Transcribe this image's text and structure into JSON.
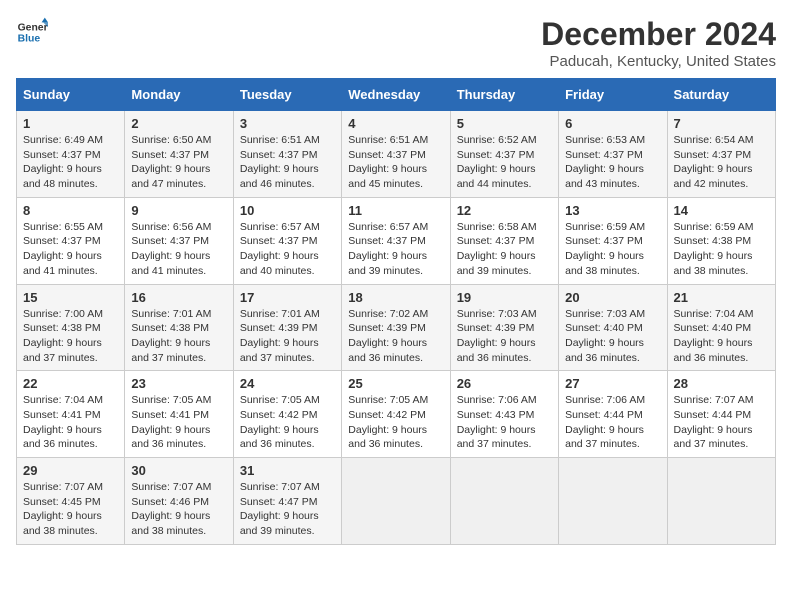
{
  "logo": {
    "line1": "General",
    "line2": "Blue"
  },
  "title": "December 2024",
  "subtitle": "Paducah, Kentucky, United States",
  "headers": [
    "Sunday",
    "Monday",
    "Tuesday",
    "Wednesday",
    "Thursday",
    "Friday",
    "Saturday"
  ],
  "weeks": [
    [
      {
        "day": "1",
        "sunrise": "6:49 AM",
        "sunset": "4:37 PM",
        "daylight": "9 hours and 48 minutes."
      },
      {
        "day": "2",
        "sunrise": "6:50 AM",
        "sunset": "4:37 PM",
        "daylight": "9 hours and 47 minutes."
      },
      {
        "day": "3",
        "sunrise": "6:51 AM",
        "sunset": "4:37 PM",
        "daylight": "9 hours and 46 minutes."
      },
      {
        "day": "4",
        "sunrise": "6:51 AM",
        "sunset": "4:37 PM",
        "daylight": "9 hours and 45 minutes."
      },
      {
        "day": "5",
        "sunrise": "6:52 AM",
        "sunset": "4:37 PM",
        "daylight": "9 hours and 44 minutes."
      },
      {
        "day": "6",
        "sunrise": "6:53 AM",
        "sunset": "4:37 PM",
        "daylight": "9 hours and 43 minutes."
      },
      {
        "day": "7",
        "sunrise": "6:54 AM",
        "sunset": "4:37 PM",
        "daylight": "9 hours and 42 minutes."
      }
    ],
    [
      {
        "day": "8",
        "sunrise": "6:55 AM",
        "sunset": "4:37 PM",
        "daylight": "9 hours and 41 minutes."
      },
      {
        "day": "9",
        "sunrise": "6:56 AM",
        "sunset": "4:37 PM",
        "daylight": "9 hours and 41 minutes."
      },
      {
        "day": "10",
        "sunrise": "6:57 AM",
        "sunset": "4:37 PM",
        "daylight": "9 hours and 40 minutes."
      },
      {
        "day": "11",
        "sunrise": "6:57 AM",
        "sunset": "4:37 PM",
        "daylight": "9 hours and 39 minutes."
      },
      {
        "day": "12",
        "sunrise": "6:58 AM",
        "sunset": "4:37 PM",
        "daylight": "9 hours and 39 minutes."
      },
      {
        "day": "13",
        "sunrise": "6:59 AM",
        "sunset": "4:37 PM",
        "daylight": "9 hours and 38 minutes."
      },
      {
        "day": "14",
        "sunrise": "6:59 AM",
        "sunset": "4:38 PM",
        "daylight": "9 hours and 38 minutes."
      }
    ],
    [
      {
        "day": "15",
        "sunrise": "7:00 AM",
        "sunset": "4:38 PM",
        "daylight": "9 hours and 37 minutes."
      },
      {
        "day": "16",
        "sunrise": "7:01 AM",
        "sunset": "4:38 PM",
        "daylight": "9 hours and 37 minutes."
      },
      {
        "day": "17",
        "sunrise": "7:01 AM",
        "sunset": "4:39 PM",
        "daylight": "9 hours and 37 minutes."
      },
      {
        "day": "18",
        "sunrise": "7:02 AM",
        "sunset": "4:39 PM",
        "daylight": "9 hours and 36 minutes."
      },
      {
        "day": "19",
        "sunrise": "7:03 AM",
        "sunset": "4:39 PM",
        "daylight": "9 hours and 36 minutes."
      },
      {
        "day": "20",
        "sunrise": "7:03 AM",
        "sunset": "4:40 PM",
        "daylight": "9 hours and 36 minutes."
      },
      {
        "day": "21",
        "sunrise": "7:04 AM",
        "sunset": "4:40 PM",
        "daylight": "9 hours and 36 minutes."
      }
    ],
    [
      {
        "day": "22",
        "sunrise": "7:04 AM",
        "sunset": "4:41 PM",
        "daylight": "9 hours and 36 minutes."
      },
      {
        "day": "23",
        "sunrise": "7:05 AM",
        "sunset": "4:41 PM",
        "daylight": "9 hours and 36 minutes."
      },
      {
        "day": "24",
        "sunrise": "7:05 AM",
        "sunset": "4:42 PM",
        "daylight": "9 hours and 36 minutes."
      },
      {
        "day": "25",
        "sunrise": "7:05 AM",
        "sunset": "4:42 PM",
        "daylight": "9 hours and 36 minutes."
      },
      {
        "day": "26",
        "sunrise": "7:06 AM",
        "sunset": "4:43 PM",
        "daylight": "9 hours and 37 minutes."
      },
      {
        "day": "27",
        "sunrise": "7:06 AM",
        "sunset": "4:44 PM",
        "daylight": "9 hours and 37 minutes."
      },
      {
        "day": "28",
        "sunrise": "7:07 AM",
        "sunset": "4:44 PM",
        "daylight": "9 hours and 37 minutes."
      }
    ],
    [
      {
        "day": "29",
        "sunrise": "7:07 AM",
        "sunset": "4:45 PM",
        "daylight": "9 hours and 38 minutes."
      },
      {
        "day": "30",
        "sunrise": "7:07 AM",
        "sunset": "4:46 PM",
        "daylight": "9 hours and 38 minutes."
      },
      {
        "day": "31",
        "sunrise": "7:07 AM",
        "sunset": "4:47 PM",
        "daylight": "9 hours and 39 minutes."
      },
      null,
      null,
      null,
      null
    ]
  ],
  "labels": {
    "sunrise": "Sunrise:",
    "sunset": "Sunset:",
    "daylight": "Daylight:"
  }
}
